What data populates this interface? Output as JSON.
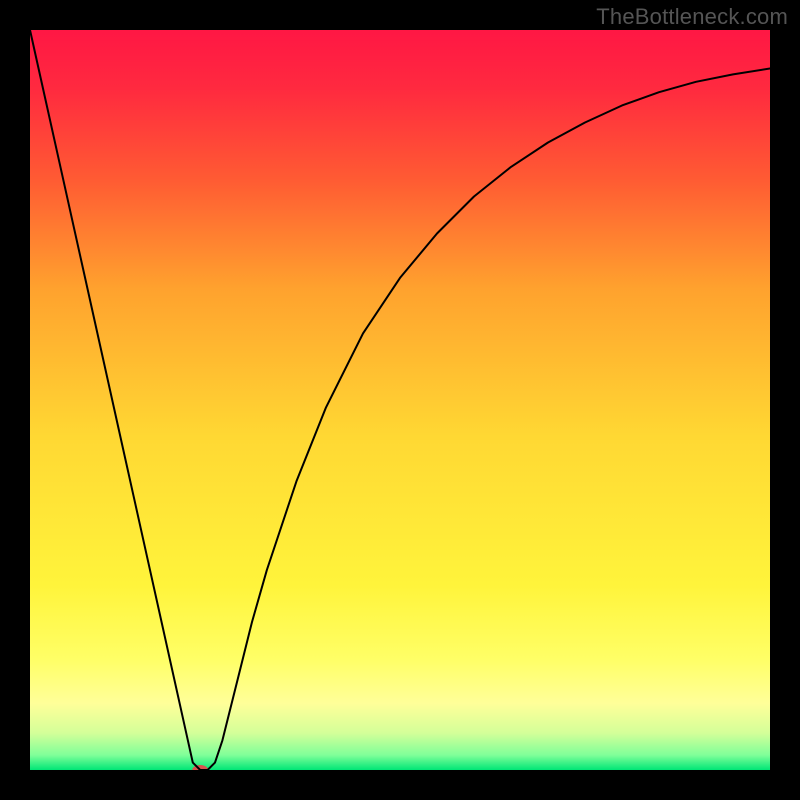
{
  "watermark": "TheBottleneck.com",
  "chart_data": {
    "type": "line",
    "title": "",
    "xlabel": "",
    "ylabel": "",
    "xlim": [
      0,
      100
    ],
    "ylim": [
      0,
      100
    ],
    "background": {
      "gradient": "vertical",
      "stops": [
        {
          "pos": 0.0,
          "color": "#ff1744"
        },
        {
          "pos": 0.08,
          "color": "#ff2a3f"
        },
        {
          "pos": 0.2,
          "color": "#ff5a33"
        },
        {
          "pos": 0.35,
          "color": "#ffa22e"
        },
        {
          "pos": 0.55,
          "color": "#ffd833"
        },
        {
          "pos": 0.75,
          "color": "#fff43b"
        },
        {
          "pos": 0.85,
          "color": "#ffff66"
        },
        {
          "pos": 0.91,
          "color": "#ffff99"
        },
        {
          "pos": 0.95,
          "color": "#d4ff99"
        },
        {
          "pos": 0.98,
          "color": "#7fff99"
        },
        {
          "pos": 1.0,
          "color": "#00e676"
        }
      ]
    },
    "curve": {
      "stroke": "#000000",
      "stroke_width": 2,
      "x": [
        0,
        2,
        4,
        6,
        8,
        10,
        12,
        14,
        16,
        18,
        20,
        21,
        22,
        23,
        24,
        25,
        26,
        28,
        30,
        32,
        34,
        36,
        40,
        45,
        50,
        55,
        60,
        65,
        70,
        75,
        80,
        85,
        90,
        95,
        100
      ],
      "y": [
        100,
        91,
        82,
        73,
        64,
        55,
        46,
        37,
        28,
        19,
        10,
        5.5,
        1,
        0,
        0,
        1,
        4,
        12,
        20,
        27,
        33,
        39,
        49,
        59,
        66.5,
        72.5,
        77.5,
        81.5,
        84.8,
        87.5,
        89.8,
        91.6,
        93,
        94,
        94.8
      ]
    },
    "marker": {
      "x": 23,
      "y": 0,
      "rx": 8,
      "ry": 5,
      "fill": "#d9534f"
    }
  }
}
